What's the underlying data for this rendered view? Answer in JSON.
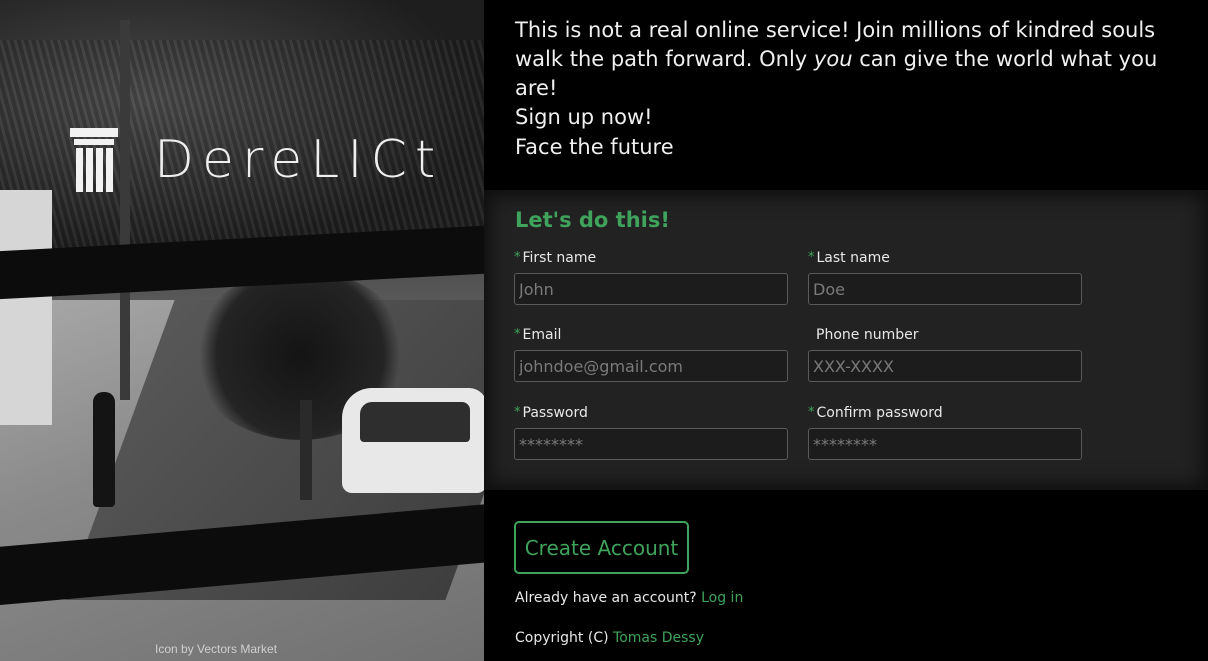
{
  "brand": {
    "name": "DereLICt",
    "icon": "pillar-icon",
    "credit": "Icon by Vectors Market"
  },
  "intro": {
    "line1_a": "This is not a real online service! Join millions of kindred souls walk the path forward. Only ",
    "line1_em": "you",
    "line1_b": " can give the world what you are!",
    "line2": "Sign up now!",
    "tagline": "Face the future"
  },
  "form": {
    "title": "Let's do this!",
    "required_marker": "*",
    "first_name": {
      "label": "First name",
      "placeholder": "John"
    },
    "last_name": {
      "label": "Last name",
      "placeholder": "Doe"
    },
    "email": {
      "label": "Email",
      "placeholder": "johndoe@gmail.com"
    },
    "phone": {
      "label": "Phone number",
      "placeholder": "XXX-XXXX"
    },
    "password": {
      "label": "Password",
      "placeholder": "********"
    },
    "confirm_password": {
      "label": "Confirm password",
      "placeholder": "********"
    },
    "submit_label": "Create Account"
  },
  "footer": {
    "login_prompt": "Already have an account?",
    "login_link": "Log in",
    "copyright": "Copyright (C)",
    "author": "Tomas Dessy"
  },
  "colors": {
    "accent": "#3fa35c",
    "background": "#000000",
    "form_bg": "#222222"
  }
}
